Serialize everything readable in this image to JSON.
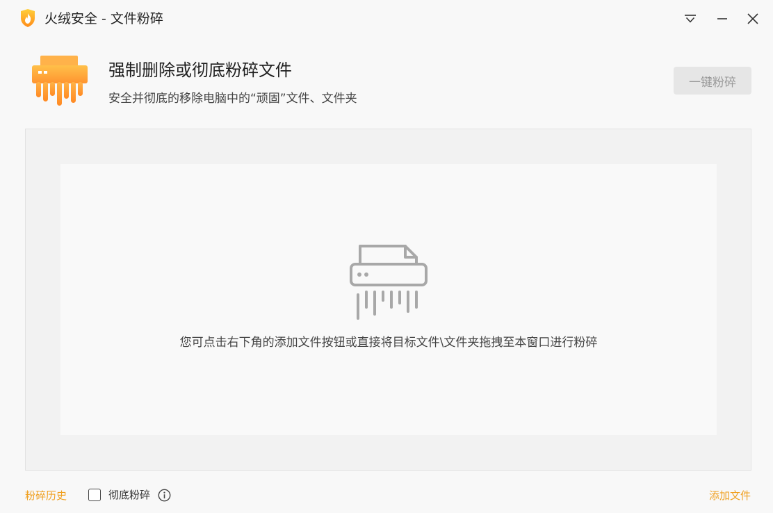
{
  "window": {
    "title": "火绒安全 - 文件粉碎",
    "controls": [
      "menu-icon",
      "minimize-icon",
      "close-icon"
    ]
  },
  "header": {
    "title": "强制删除或彻底粉碎文件",
    "subtitle": "安全并彻底的移除电脑中的“顽固”文件、文件夹",
    "shred_button_label": "一键粉碎",
    "icon": "shredder-icon"
  },
  "drop_zone": {
    "hint": "您可点击右下角的添加文件按钮或直接将目标文件\\文件夹拖拽至本窗口进行粉碎",
    "icon": "shredder-outline-icon"
  },
  "footer": {
    "history_link": "粉碎历史",
    "thorough_checkbox_label": "彻底粉碎",
    "thorough_checked": false,
    "add_file_link": "添加文件"
  },
  "colors": {
    "accent": "#f0a020",
    "logo_orange": "#ff9a2e",
    "disabled_button_bg": "#e6e6e6",
    "disabled_button_text": "#9a9a9a"
  }
}
